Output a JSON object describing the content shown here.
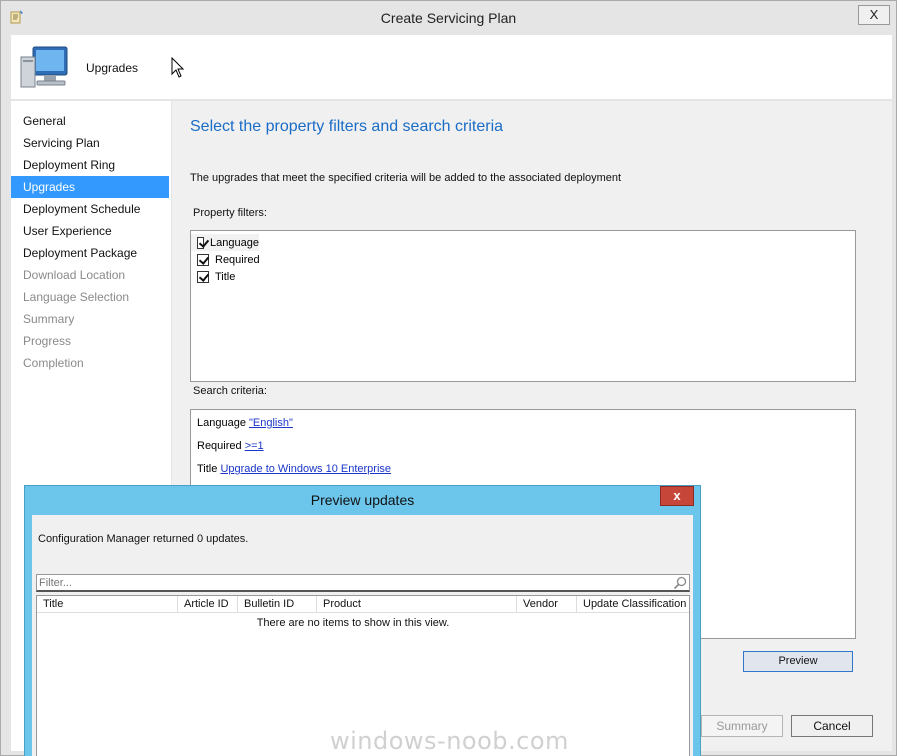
{
  "window": {
    "title": "Create Servicing Plan",
    "close_label": "X"
  },
  "header": {
    "title": "Upgrades"
  },
  "nav": [
    {
      "label": "General",
      "state": "normal"
    },
    {
      "label": "Servicing Plan",
      "state": "normal"
    },
    {
      "label": "Deployment Ring",
      "state": "normal"
    },
    {
      "label": "Upgrades",
      "state": "active"
    },
    {
      "label": "Deployment Schedule",
      "state": "normal"
    },
    {
      "label": "User Experience",
      "state": "normal"
    },
    {
      "label": "Deployment Package",
      "state": "normal"
    },
    {
      "label": "Download Location",
      "state": "disabled"
    },
    {
      "label": "Language Selection",
      "state": "disabled"
    },
    {
      "label": "Summary",
      "state": "disabled"
    },
    {
      "label": "Progress",
      "state": "disabled"
    },
    {
      "label": "Completion",
      "state": "disabled"
    }
  ],
  "content": {
    "heading": "Select the property filters and search criteria",
    "description": "The upgrades that meet the specified criteria will be added to the associated deployment",
    "property_filters_label": "Property filters:",
    "property_filters": [
      {
        "label": "Language",
        "checked": true
      },
      {
        "label": "Required",
        "checked": true
      },
      {
        "label": "Title",
        "checked": true
      }
    ],
    "search_criteria_label": "Search criteria:",
    "search_criteria": [
      {
        "name": "Language",
        "value": "\"English\""
      },
      {
        "name": "Required",
        "value": ">=1"
      },
      {
        "name": "Title",
        "value": "Upgrade to Windows 10 Enterprise"
      }
    ],
    "preview_button": "Preview",
    "summary_button": "Summary",
    "cancel_button": "Cancel"
  },
  "dialog": {
    "title": "Preview updates",
    "close_label": "x",
    "message": "Configuration Manager returned 0 updates.",
    "filter_placeholder": "Filter...",
    "columns": [
      "Title",
      "Article ID",
      "Bulletin ID",
      "Product",
      "Vendor",
      "Update Classification"
    ],
    "empty_text": "There are no items to show in this view."
  },
  "watermark": "windows-noob.com",
  "colors": {
    "accent": "#3399ff",
    "heading": "#1a6cc7",
    "dialog_frame": "#6cc6ec",
    "dialog_close": "#c7463a"
  }
}
